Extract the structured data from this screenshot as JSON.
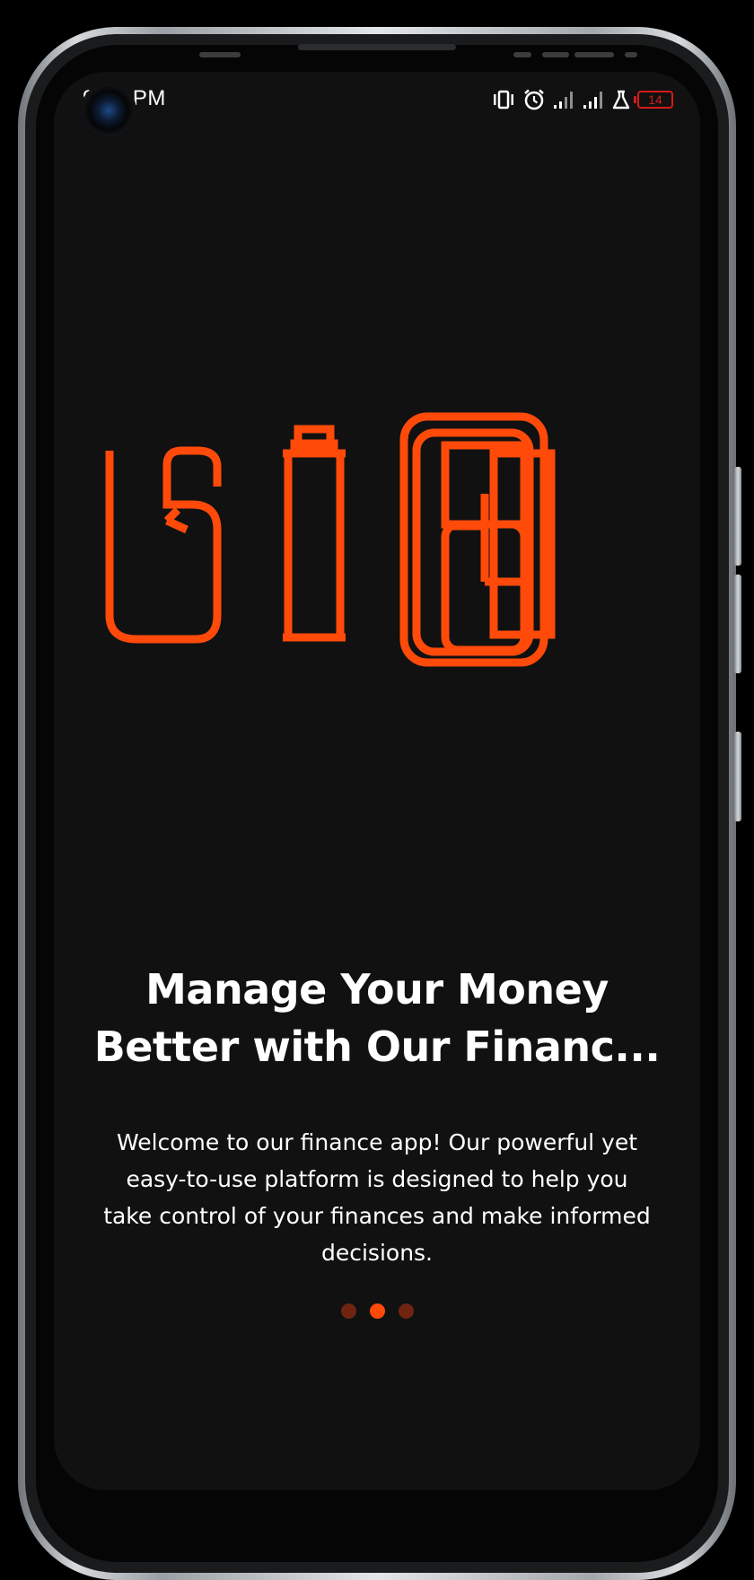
{
  "status_bar": {
    "time": "9:41 PM",
    "icons": [
      "vibrate-icon",
      "alarm-icon",
      "signal-icon",
      "signal-icon",
      "lab-flask-icon",
      "battery-icon"
    ],
    "battery_level": "14",
    "battery_color": "#d51a1a"
  },
  "onboarding": {
    "logo_icon": "brand-logo-icon",
    "accent_color": "#ff4a0a",
    "headline_lines": [
      "Manage Your Money",
      "Better with Our Financ..."
    ],
    "description_lines": [
      "Welcome to our finance app! Our powerful yet",
      "easy-to-use platform is designed to help you",
      "take control of your finances and make informed",
      "decisions."
    ],
    "pager": {
      "total": 3,
      "active_index": 1,
      "active_color": "#ff4a0a",
      "inactive_color": "#6e2410"
    }
  }
}
